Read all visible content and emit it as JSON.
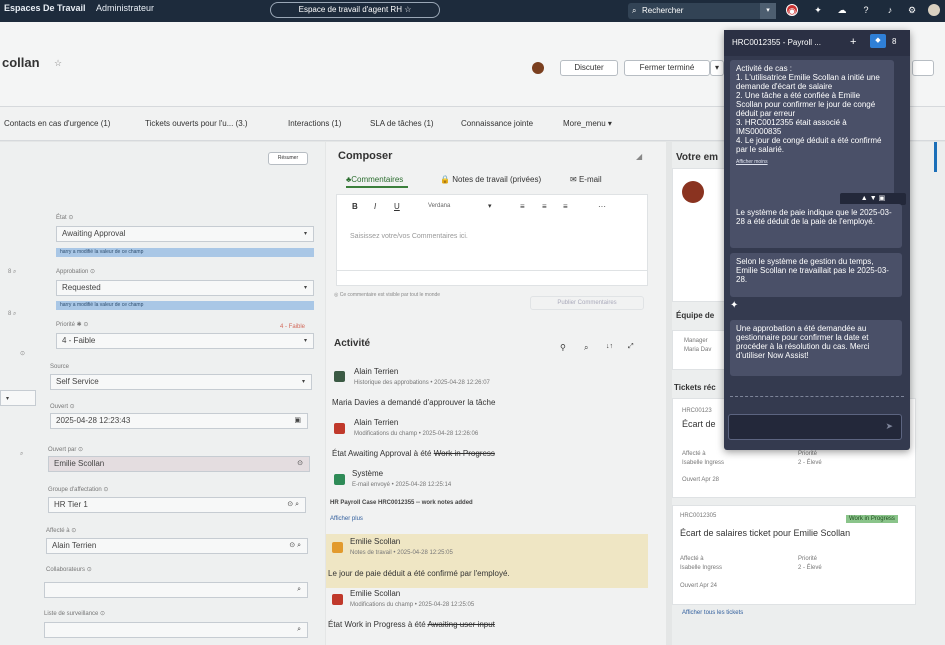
{
  "topbar": {
    "brand": "Espaces De Travail",
    "admin": "Administrateur",
    "workspace": "Espace de travail d'agent RH ☆",
    "search_placeholder": "Rechercher"
  },
  "header": {
    "record_title": "collan",
    "discuss_button": "Discuter",
    "close_button": "Fermer terminé"
  },
  "tabs": [
    "Contacts en cas d'urgence (1)",
    "Tickets ouverts pour l'u... (3.)",
    "Interactions (1)",
    "SLA de tâches (1)",
    "Connaissance jointe",
    "More_menu ▾"
  ],
  "form": {
    "resume_button": "Résumer",
    "state_label": "État ⊙",
    "state_value": "Awaiting Approval",
    "state_hint": "harry a modifié la valeur de ce champ",
    "approval_label": "Approbation ⊙",
    "approval_value": "Requested",
    "approval_hint": "harry a modifié la valeur de ce champ",
    "priority_label": "Priorité ✱ ⊙",
    "priority_tag": "4 - Faible",
    "priority_value": "4 - Faible",
    "source_label": "Source",
    "source_value": "Self Service",
    "opened_label": "Ouvert ⊙",
    "opened_value": "2025-04-28 12:23:43",
    "opened_by_label": "Ouvert par ⊙",
    "opened_by_value": "Emilie Scollan",
    "assign_group_label": "Groupe d'affectation ⊙",
    "assign_group_value": "HR Tier 1",
    "assigned_to_label": "Affecté à ⊙",
    "assigned_to_value": "Alain Terrien",
    "collaborators_label": "Collaborateurs ⊙",
    "watchlist_label": "Liste de surveillance ⊙"
  },
  "composer": {
    "title": "Composer",
    "tab_comments": "Commentaires",
    "tab_worknotes": "Notes de travail (privées)",
    "tab_email": "E-mail",
    "font_name": "Verdana",
    "placeholder": "Saisissez votre/vos Commentaires ici.",
    "visible_note": "Ce commentaire est visible par tout le monde",
    "publish_button": "Publier Commentaires"
  },
  "activity": {
    "title": "Activité",
    "entries": [
      {
        "author": "Alain Terrien",
        "meta": "Historique des approbations • 2025-04-28 12:26:07",
        "text": "Maria Davies a demandé d'approuver la tâche"
      },
      {
        "author": "Alain Terrien",
        "meta": "Modifications du champ • 2025-04-28 12:26:06",
        "text": "État  Awaiting Approval à été",
        "strike": "Work in Progress"
      },
      {
        "author": "Système",
        "meta": "E-mail envoyé • 2025-04-28 12:25:14",
        "text": "HR Payroll Case HRC0012355 -- work notes added",
        "link": "Afficher plus"
      },
      {
        "author": "Emilie Scollan",
        "meta": "Notes de travail • 2025-04-28 12:25:05",
        "text": "Le jour de paie déduit a été confirmé par l'employé."
      },
      {
        "author": "Emilie Scollan",
        "meta": "Modifications du champ • 2025-04-28 12:25:05",
        "text": "État  Work in Progress à été",
        "strike": "Awaiting user input"
      }
    ]
  },
  "right": {
    "your_title": "Votre em",
    "team_title": "Équipe de",
    "manager_label": "Manager",
    "manager_value": "Maria Dav",
    "tickets_title": "Tickets réc",
    "ticket1_num": "HRC00123",
    "ticket1_title": "Écart de",
    "ticket1_assigned_label": "Affecté à",
    "ticket1_assigned": "Isabelle Ingress",
    "ticket1_priority_label": "Priorité",
    "ticket1_priority": "2 - Élevé",
    "ticket1_opened": "Ouvert Apr 28",
    "ticket2_num": "HRC0012305",
    "ticket2_badge": "Work in Progress",
    "ticket2_title": "Écart de salaires ticket pour Emilie Scollan",
    "ticket2_assigned_label": "Affecté à",
    "ticket2_assigned": "Isabelle Ingress",
    "ticket2_priority_label": "Priorité",
    "ticket2_priority": "2 - Élevé",
    "ticket2_opened": "Ouvert Apr 24",
    "all_tickets": "Afficher tous les tickets"
  },
  "assist": {
    "title": "HRC0012355 - Payroll ...",
    "badge_count": "8",
    "summary_lines": [
      "Activité de cas :",
      "1. L'utilisatrice Emilie Scollan a initié une demande d'écart de salaire",
      "2. Une tâche a été confiée à Emilie Scollan pour confirmer le jour de congé déduit par erreur",
      "3. HRC0012355 était associé à IMS0000835",
      "4. Le jour de congé déduit a été confirmé par le salarié."
    ],
    "show_less": "Afficher moins",
    "msg1": "Le système de paie indique que le 2025-03-28 a été déduit de la paie de l'employé.",
    "msg2": "Selon le système de gestion du temps, Emilie Scollan ne travaillait pas le 2025-03-28.",
    "msg3": "Une approbation a été demandée au gestionnaire pour confirmer la date et procéder à la résolution du cas. Merci d'utiliser Now Assist!"
  }
}
